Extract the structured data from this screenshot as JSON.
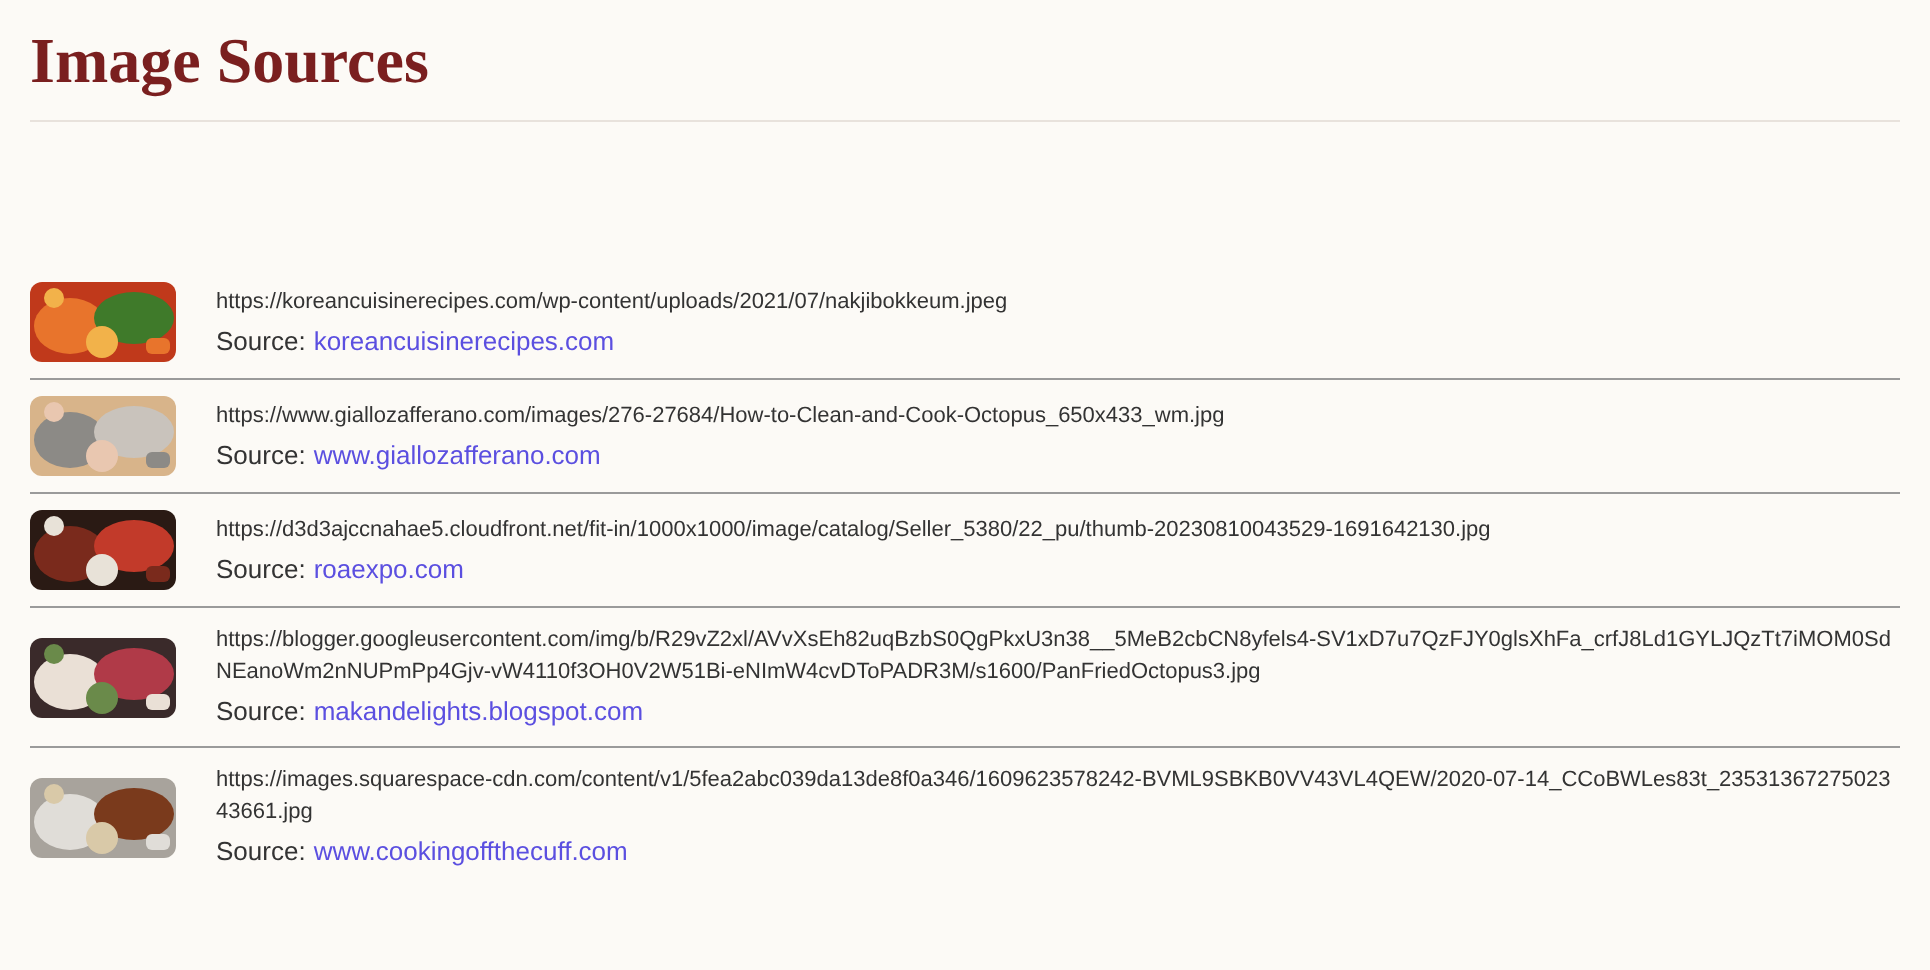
{
  "title": "Image Sources",
  "sources": [
    {
      "url": "https://koreancuisinerecipes.com/wp-content/uploads/2021/07/nakjibokkeum.jpeg",
      "label": "Source:",
      "site": "koreancuisinerecipes.com"
    },
    {
      "url": "https://www.giallozafferano.com/images/276-27684/How-to-Clean-and-Cook-Octopus_650x433_wm.jpg",
      "label": "Source:",
      "site": "www.giallozafferano.com"
    },
    {
      "url": "https://d3d3ajccnahae5.cloudfront.net/fit-in/1000x1000/image/catalog/Seller_5380/22_pu/thumb-20230810043529-1691642130.jpg",
      "label": "Source:",
      "site": "roaexpo.com"
    },
    {
      "url": "https://blogger.googleusercontent.com/img/b/R29vZ2xl/AVvXsEh82uqBzbS0QgPkxU3n38__5MeB2cbCN8yfels4-SV1xD7u7QzFJY0glsXhFa_crfJ8Ld1GYLJQzTt7iMOM0SdNEanoWm2nNUPmPp4Gjv-vW4110f3OH0V2W51Bi-eNImW4cvDToPADR3M/s1600/PanFriedOctopus3.jpg",
      "label": "Source:",
      "site": "makandelights.blogspot.com"
    },
    {
      "url": "https://images.squarespace-cdn.com/content/v1/5fea2abc039da13de8f0a346/1609623578242-BVML9SBKB0VV43VL4QEW/2020-07-14_CCoBWLes83t_2353136727502343661.jpg",
      "label": "Source:",
      "site": "www.cookingoffthecuff.com"
    }
  ]
}
